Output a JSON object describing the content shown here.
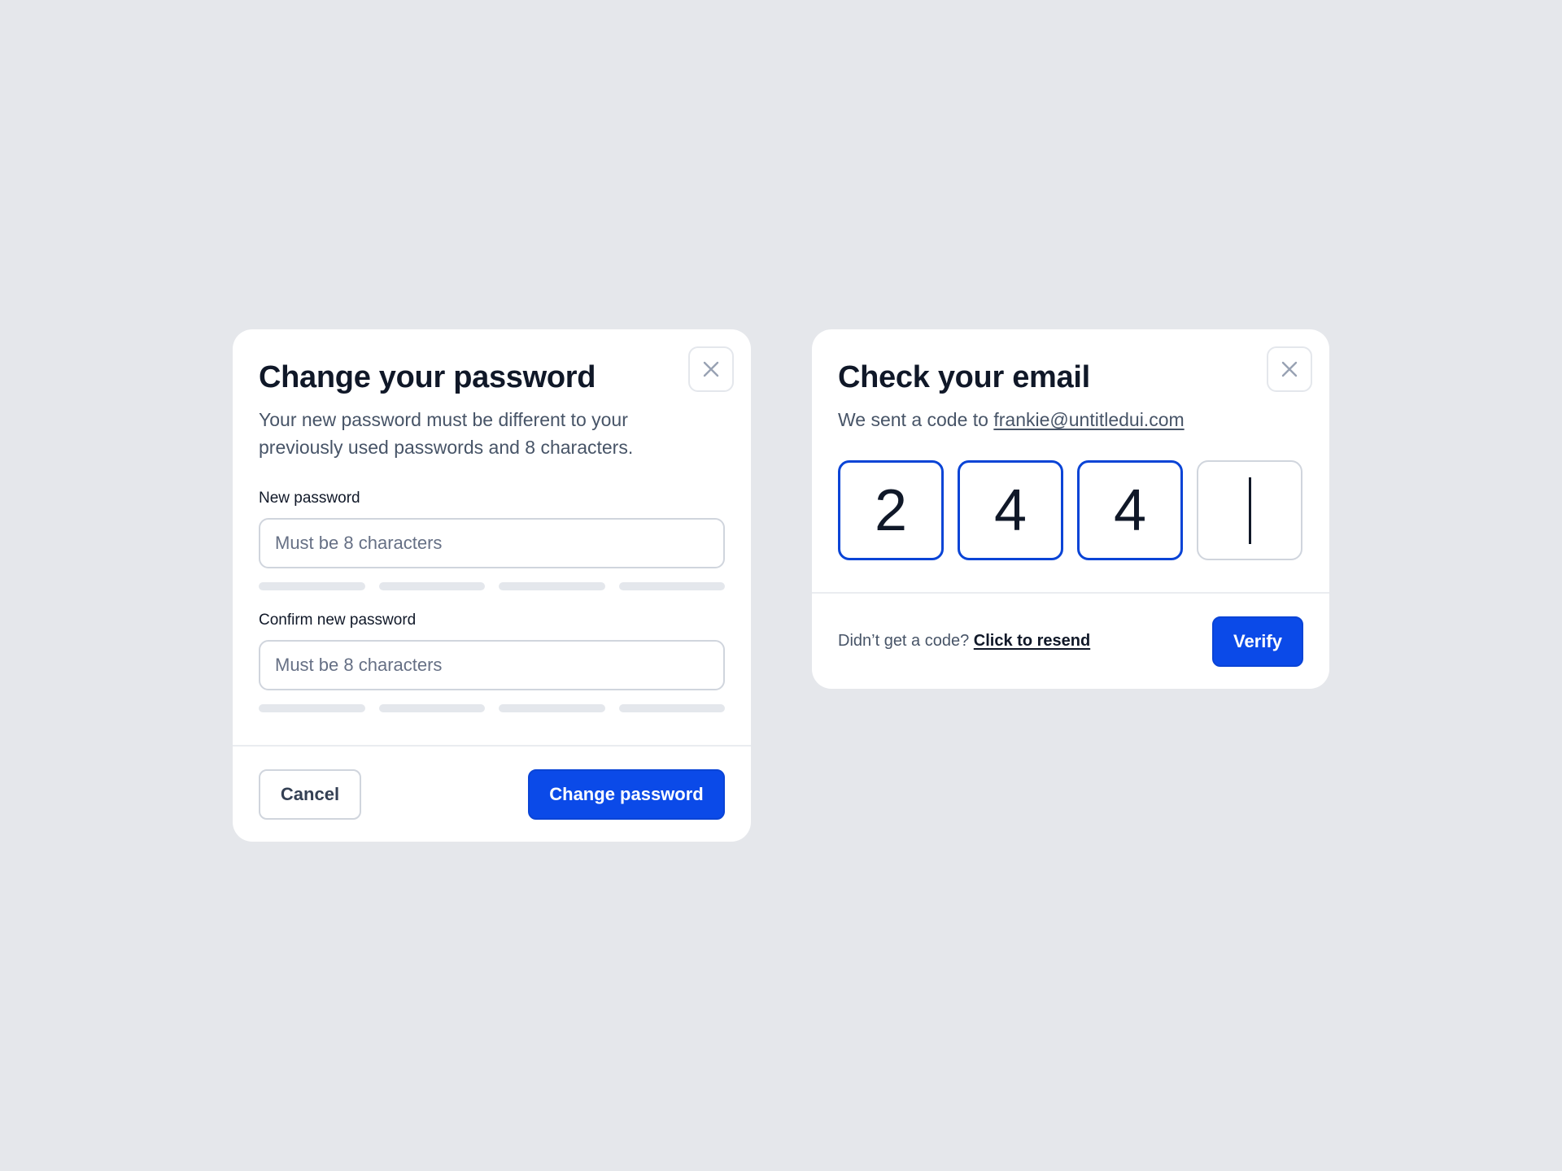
{
  "change_password": {
    "title": "Change your password",
    "description": "Your new password must be different to your previously used passwords and 8 characters.",
    "new_password": {
      "label": "New password",
      "placeholder": "Must be 8 characters",
      "value": "",
      "strength_segments_filled": 0,
      "strength_segments_total": 4
    },
    "confirm_password": {
      "label": "Confirm new password",
      "placeholder": "Must be 8 characters",
      "value": "",
      "strength_segments_filled": 0,
      "strength_segments_total": 4
    },
    "cancel_label": "Cancel",
    "submit_label": "Change password",
    "close_icon": "close-icon"
  },
  "check_email": {
    "title": "Check your email",
    "sent_prefix": "We sent a code to",
    "email": "frankie@untitledui.com",
    "code_digits": [
      "2",
      "4",
      "4",
      ""
    ],
    "resend_prefix": "Didn’t get a code?",
    "resend_label": "Click to resend",
    "verify_label": "Verify",
    "close_icon": "close-icon"
  },
  "colors": {
    "background": "#e5e7eb",
    "primary": "#0b4ae8",
    "text_primary": "#101828",
    "text_secondary": "#475467",
    "border": "#d0d5dd",
    "strength_empty": "#e4e7ec"
  }
}
